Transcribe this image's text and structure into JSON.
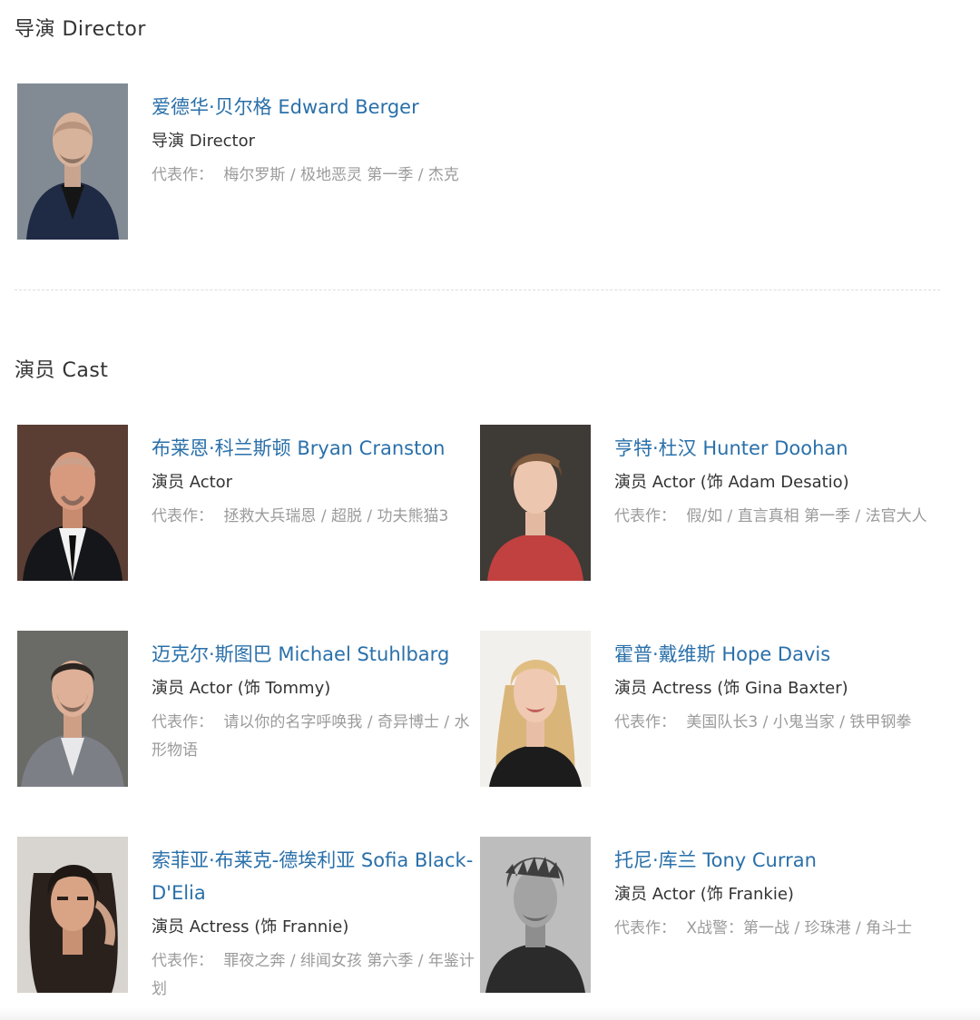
{
  "director_section": {
    "title": "导演 Director"
  },
  "cast_section": {
    "title": "演员 Cast"
  },
  "works_label": "代表作：",
  "director": {
    "name": "爱德华·贝尔格 Edward Berger",
    "role": "导演 Director",
    "works": [
      "梅尔罗斯",
      "极地恶灵 第一季",
      "杰克"
    ]
  },
  "cast": [
    {
      "name": "布莱恩·科兰斯顿 Bryan Cranston",
      "role": "演员 Actor",
      "works": [
        "拯救大兵瑞恩",
        "超脱",
        "功夫熊猫3"
      ]
    },
    {
      "name": "亨特·杜汉 Hunter Doohan",
      "role": "演员 Actor (饰 Adam Desatio)",
      "works": [
        "假/如",
        "直言真相 第一季",
        "法官大人"
      ]
    },
    {
      "name": "迈克尔·斯图巴 Michael Stuhlbarg",
      "role": "演员 Actor (饰 Tommy)",
      "works": [
        "请以你的名字呼唤我",
        "奇异博士",
        "水形物语"
      ]
    },
    {
      "name": "霍普·戴维斯 Hope Davis",
      "role": "演员 Actress (饰 Gina Baxter)",
      "works": [
        "美国队长3",
        "小鬼当家",
        "铁甲钢拳"
      ]
    },
    {
      "name": "索菲亚·布莱克-德埃利亚 Sofia Black-D'Elia",
      "role": "演员 Actress (饰 Frannie)",
      "works": [
        "罪夜之奔",
        "绯闻女孩 第六季",
        "年鉴计划"
      ]
    },
    {
      "name": "托尼·库兰 Tony Curran",
      "role": "演员 Actor (饰 Frankie)",
      "works": [
        "X战警：第一战",
        "珍珠港",
        "角斗士"
      ]
    }
  ]
}
